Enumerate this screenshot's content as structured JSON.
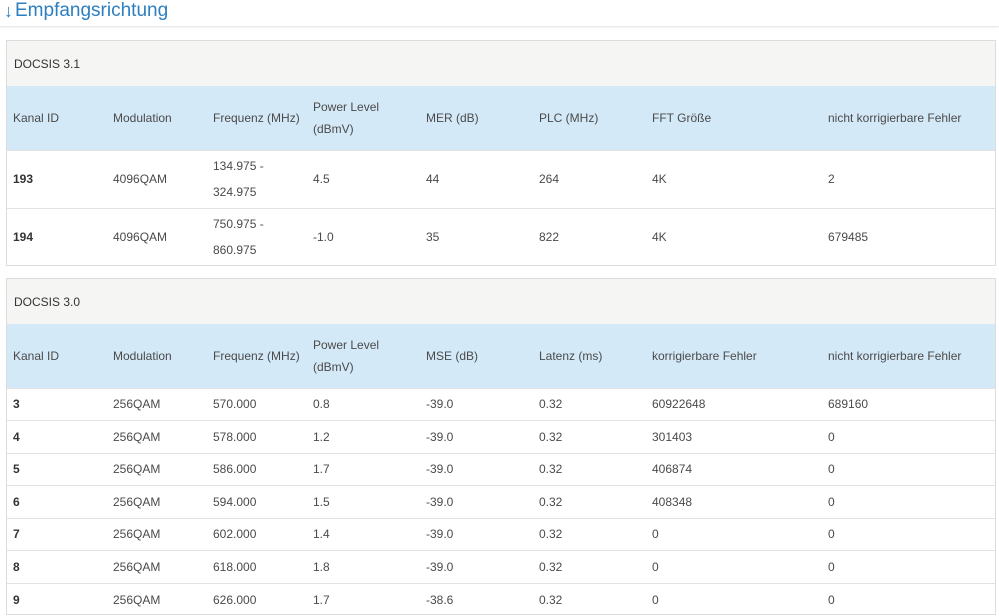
{
  "header": {
    "arrow": "↓",
    "title": "Empfangsrichtung"
  },
  "docsis31": {
    "caption": "DOCSIS 3.1",
    "columns": [
      "Kanal ID",
      "Modulation",
      "Frequenz (MHz)",
      "Power Level (dBmV)",
      "MER (dB)",
      "PLC (MHz)",
      "FFT Größe",
      "nicht korrigierbare Fehler"
    ],
    "rows": [
      [
        "193",
        "4096QAM",
        "134.975 - 324.975",
        "4.5",
        "44",
        "264",
        "4K",
        "2"
      ],
      [
        "194",
        "4096QAM",
        "750.975 - 860.975",
        "-1.0",
        "35",
        "822",
        "4K",
        "679485"
      ]
    ]
  },
  "docsis30": {
    "caption": "DOCSIS 3.0",
    "columns": [
      "Kanal ID",
      "Modulation",
      "Frequenz (MHz)",
      "Power Level (dBmV)",
      "MSE (dB)",
      "Latenz (ms)",
      "korrigierbare Fehler",
      "nicht korrigierbare Fehler"
    ],
    "rows": [
      [
        "3",
        "256QAM",
        "570.000",
        "0.8",
        "-39.0",
        "0.32",
        "60922648",
        "689160"
      ],
      [
        "4",
        "256QAM",
        "578.000",
        "1.2",
        "-39.0",
        "0.32",
        "301403",
        "0"
      ],
      [
        "5",
        "256QAM",
        "586.000",
        "1.7",
        "-39.0",
        "0.32",
        "406874",
        "0"
      ],
      [
        "6",
        "256QAM",
        "594.000",
        "1.5",
        "-39.0",
        "0.32",
        "408348",
        "0"
      ],
      [
        "7",
        "256QAM",
        "602.000",
        "1.4",
        "-39.0",
        "0.32",
        "0",
        "0"
      ],
      [
        "8",
        "256QAM",
        "618.000",
        "1.8",
        "-39.0",
        "0.32",
        "0",
        "0"
      ],
      [
        "9",
        "256QAM",
        "626.000",
        "1.7",
        "-38.6",
        "0.32",
        "0",
        "0"
      ]
    ]
  }
}
